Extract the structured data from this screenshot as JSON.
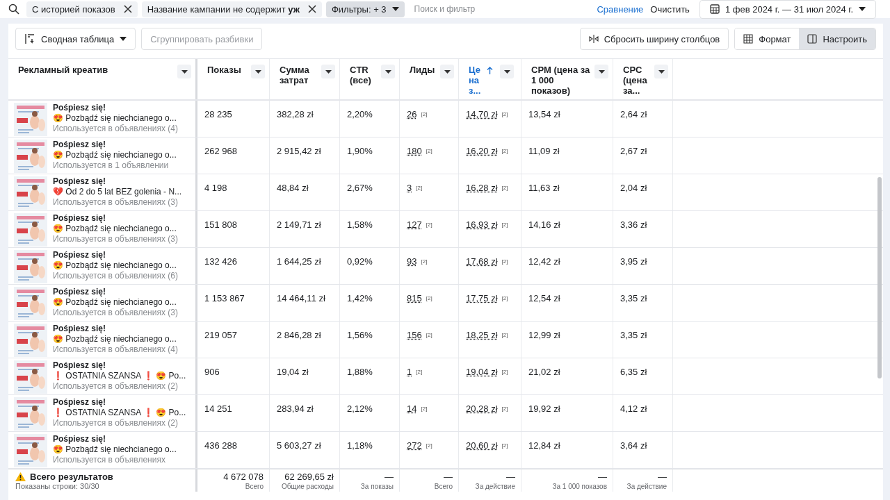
{
  "filter_bar": {
    "chips": [
      {
        "label": "С историей показов"
      },
      {
        "label": "Название кампании не содержит **уж**"
      }
    ],
    "filters_button": "Фильтры: + 3",
    "search": {
      "placeholder": "Поиск и фильтр"
    },
    "compare_link": "Сравнение",
    "clear_button": "Очистить",
    "date_range": "1 фев 2024 г. — 31 июл 2024 г."
  },
  "toolbar": {
    "view_button": "Сводная таблица",
    "group_button": {
      "label": "Сгруппировать разбивки",
      "disabled": true
    },
    "reset_button": "Сбросить ширину столбцов",
    "segments": [
      {
        "label": "Формат",
        "selected": false
      },
      {
        "label": "Настроить",
        "selected": true
      }
    ]
  },
  "table": {
    "columns": [
      {
        "label": "Рекламный креатив",
        "sorted": false
      },
      {
        "label": "Показы",
        "sorted": false
      },
      {
        "label": "Сумма затрат",
        "sorted": false
      },
      {
        "label": "CTR (все)",
        "sorted": false
      },
      {
        "label": "Лиды",
        "sorted": false
      },
      {
        "label": "Це на з...",
        "sorted": true
      },
      {
        "label": "CPM (цена за 1 000 показов)",
        "sorted": false
      },
      {
        "label": "CPC (цена за...",
        "sorted": false
      }
    ],
    "rows": [
      {
        "title": "Pośpiesz się!",
        "text": "😍 Pozbądź się niechcianego o...",
        "usage": "Используется в объявлениях (4)",
        "impressions": "28 235",
        "spend": "382,28 zł",
        "ctr": "2,20%",
        "leads": "26",
        "leads_note": "[2]",
        "cpl": "14,70 zł",
        "cpl_note": "[2]",
        "cpm": "13,54 zł",
        "cpc": "2,64 zł"
      },
      {
        "title": "Pośpiesz się!",
        "text": "😍 Pozbądź się niechcianego o...",
        "usage": "Используется в 1 объявлении",
        "impressions": "262 968",
        "spend": "2 915,42 zł",
        "ctr": "1,90%",
        "leads": "180",
        "leads_note": "[2]",
        "cpl": "16,20 zł",
        "cpl_note": "[2]",
        "cpm": "11,09 zł",
        "cpc": "2,67 zł"
      },
      {
        "title": "Pośpiesz się!",
        "text": "💔 Od 2 do 5 lat BEZ golenia - N...",
        "usage": "Используется в объявлениях (3)",
        "impressions": "4 198",
        "spend": "48,84 zł",
        "ctr": "2,67%",
        "leads": "3",
        "leads_note": "[2]",
        "cpl": "16,28 zł",
        "cpl_note": "[2]",
        "cpm": "11,63 zł",
        "cpc": "2,04 zł"
      },
      {
        "title": "Pośpiesz się!",
        "text": "😍 Pozbądź się niechcianego o...",
        "usage": "Используется в объявлениях (3)",
        "impressions": "151 808",
        "spend": "2 149,71 zł",
        "ctr": "1,58%",
        "leads": "127",
        "leads_note": "[2]",
        "cpl": "16,93 zł",
        "cpl_note": "[2]",
        "cpm": "14,16 zł",
        "cpc": "3,36 zł"
      },
      {
        "title": "Pośpiesz się!",
        "text": "😍 Pozbądź się niechcianego o...",
        "usage": "Используется в объявлениях (6)",
        "impressions": "132 426",
        "spend": "1 644,25 zł",
        "ctr": "0,92%",
        "leads": "93",
        "leads_note": "[2]",
        "cpl": "17,68 zł",
        "cpl_note": "[2]",
        "cpm": "12,42 zł",
        "cpc": "3,95 zł"
      },
      {
        "title": "Pośpiesz się!",
        "text": "😍 Pozbądź się niechcianego o...",
        "usage": "Используется в объявлениях (3)",
        "impressions": "1 153 867",
        "spend": "14 464,11 zł",
        "ctr": "1,42%",
        "leads": "815",
        "leads_note": "[2]",
        "cpl": "17,75 zł",
        "cpl_note": "[2]",
        "cpm": "12,54 zł",
        "cpc": "3,35 zł"
      },
      {
        "title": "Pośpiesz się!",
        "text": "😍 Pozbądź się niechcianego o...",
        "usage": "Используется в объявлениях (4)",
        "impressions": "219 057",
        "spend": "2 846,28 zł",
        "ctr": "1,56%",
        "leads": "156",
        "leads_note": "[2]",
        "cpl": "18,25 zł",
        "cpl_note": "[2]",
        "cpm": "12,99 zł",
        "cpc": "3,35 zł"
      },
      {
        "title": "Pośpiesz się!",
        "text": "❗ OSTATNIA SZANSA ❗ 😍 Po...",
        "usage": "Используется в объявлениях (2)",
        "impressions": "906",
        "spend": "19,04 zł",
        "ctr": "1,88%",
        "leads": "1",
        "leads_note": "[2]",
        "cpl": "19,04 zł",
        "cpl_note": "[2]",
        "cpm": "21,02 zł",
        "cpc": "6,35 zł"
      },
      {
        "title": "Pośpiesz się!",
        "text": "❗ OSTATNIA SZANSA ❗ 😍 Po...",
        "usage": "Используется в объявлениях (2)",
        "impressions": "14 251",
        "spend": "283,94 zł",
        "ctr": "2,12%",
        "leads": "14",
        "leads_note": "[2]",
        "cpl": "20,28 zł",
        "cpl_note": "[2]",
        "cpm": "19,92 zł",
        "cpc": "4,12 zł"
      },
      {
        "title": "Pośpiesz się!",
        "text": "😍 Pozbądź się niechcianego o...",
        "usage": "Используется в объявлениях",
        "impressions": "436 288",
        "spend": "5 603,27 zł",
        "ctr": "1,18%",
        "leads": "272",
        "leads_note": "[2]",
        "cpl": "20,60 zł",
        "cpl_note": "[2]",
        "cpm": "12,84 zł",
        "cpc": "3,64 zł"
      }
    ],
    "totals": {
      "title": "Всего результатов",
      "subtitle": "Показаны строки: 30/30",
      "cells": [
        {
          "value": "4 672 078",
          "label": "Всего"
        },
        {
          "value": "62 269,65 zł",
          "label": "Общие расходы"
        },
        {
          "value": "—",
          "label": "За показы"
        },
        {
          "value": "—",
          "label": "Всего"
        },
        {
          "value": "—",
          "label": "За действие"
        },
        {
          "value": "—",
          "label": "За 1 000 показов"
        },
        {
          "value": "—",
          "label": "За действие"
        }
      ]
    }
  }
}
